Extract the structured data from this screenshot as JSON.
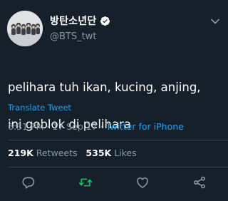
{
  "author": {
    "display_name": "방탄소년단",
    "handle": "@BTS_twt",
    "verified": true
  },
  "tweet": {
    "line1": "pelihara tuh ikan, kucing, anjing,",
    "line2": "ini goblok di pelihara"
  },
  "translate_label": "Translate Tweet",
  "meta": {
    "time": "6:31 PM",
    "separator": "·",
    "date": "17 Sep 17",
    "source": "Twitter for iPhone"
  },
  "stats": {
    "retweets_count": "219K",
    "retweets_label": "Retweets",
    "likes_count": "535K",
    "likes_label": "Likes"
  },
  "actions": [
    {
      "icon": "reply-icon"
    },
    {
      "icon": "retweet-icon"
    },
    {
      "icon": "like-icon"
    },
    {
      "icon": "share-icon"
    }
  ],
  "colors": {
    "background": "#15202b",
    "text": "#ffffff",
    "secondary": "#8899a6",
    "link": "#1da1f2",
    "retweeted": "#17bf63",
    "divider": "#38444d"
  }
}
